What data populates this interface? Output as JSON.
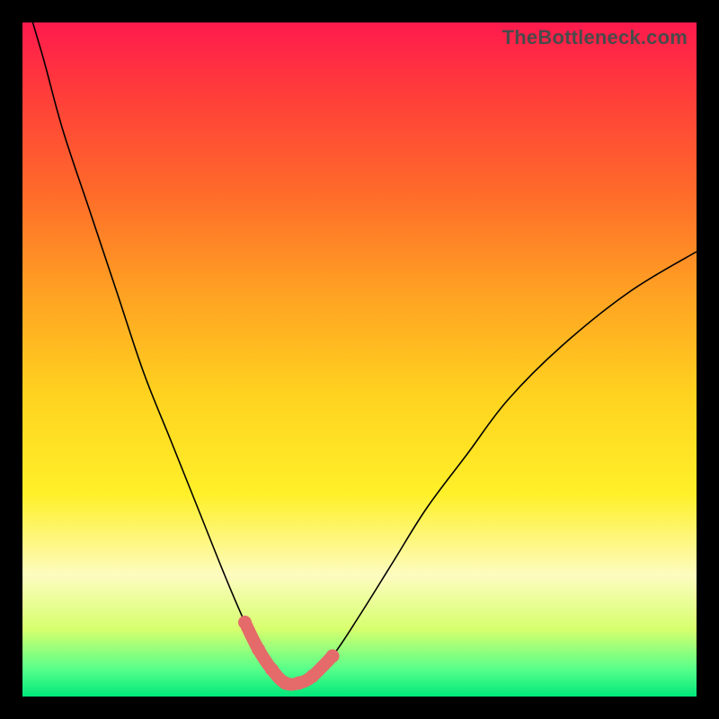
{
  "watermark": "TheBottleneck.com",
  "chart_data": {
    "type": "line",
    "title": "",
    "xlabel": "",
    "ylabel": "",
    "xlim": [
      0,
      100
    ],
    "ylim": [
      0,
      100
    ],
    "legend": false,
    "grid": false,
    "series": [
      {
        "name": "bottleneck-curve",
        "x": [
          0,
          3,
          6,
          10,
          14,
          18,
          22,
          26,
          30,
          33,
          35,
          37,
          39,
          41,
          43,
          46,
          50,
          55,
          60,
          66,
          72,
          80,
          90,
          100
        ],
        "y": [
          105,
          95,
          84,
          72,
          60,
          48,
          38,
          28,
          18,
          11,
          7,
          4,
          2,
          2,
          3,
          6,
          12,
          20,
          28,
          36,
          44,
          52,
          60,
          66
        ]
      }
    ],
    "annotations": [
      {
        "name": "optimal-range-highlight",
        "x_range": [
          33,
          46
        ],
        "color": "#e56a6a"
      }
    ],
    "background_gradient": {
      "direction": "vertical",
      "stops": [
        {
          "pos": 0.0,
          "color": "#ff1a4d"
        },
        {
          "pos": 0.55,
          "color": "#ffd21f"
        },
        {
          "pos": 0.82,
          "color": "#fdfcc0"
        },
        {
          "pos": 1.0,
          "color": "#00e87b"
        }
      ]
    }
  }
}
